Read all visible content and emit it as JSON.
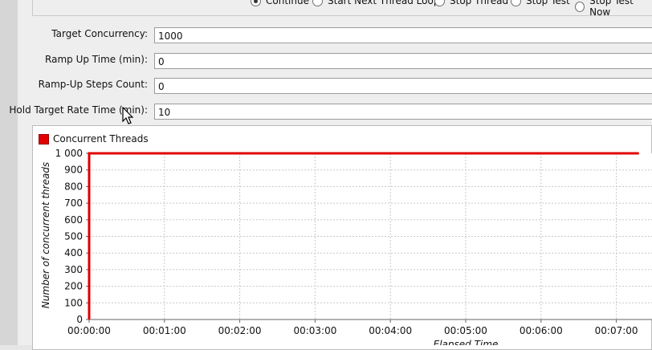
{
  "radio_options": [
    {
      "label": "Continue",
      "checked": true
    },
    {
      "label": "Start Next Thread Loop",
      "checked": false
    },
    {
      "label": "Stop Thread",
      "checked": false
    },
    {
      "label": "Stop Test",
      "checked": false
    },
    {
      "label": "Stop Test Now",
      "checked": false
    }
  ],
  "form": {
    "target_concurrency": {
      "label": "Target Concurrency:",
      "value": "1000"
    },
    "ramp_up_time": {
      "label": "Ramp Up Time (min):",
      "value": "0"
    },
    "ramp_up_steps": {
      "label": "Ramp-Up Steps Count:",
      "value": "0"
    },
    "hold_time": {
      "label": "Hold Target Rate Time (min):",
      "value": "10"
    }
  },
  "chart_data": {
    "type": "line",
    "legend": "top-left",
    "ylabel": "Number of concurrent threads",
    "xlabel": "Elapsed Time",
    "y_ticks": [
      "1 000",
      "900",
      "800",
      "700",
      "600",
      "500",
      "400",
      "300",
      "200",
      "100",
      "0"
    ],
    "x_ticks": [
      "00:00:00",
      "00:01:00",
      "00:02:00",
      "00:03:00",
      "00:04:00",
      "00:05:00",
      "00:06:00",
      "00:07:00"
    ],
    "ylim": [
      0,
      1000
    ],
    "xlim_minutes": [
      0,
      7.3
    ],
    "grid": true,
    "series": [
      {
        "name": "Concurrent Threads",
        "color": "#e00000",
        "points": [
          [
            0,
            0
          ],
          [
            0,
            1000
          ],
          [
            7.3,
            1000
          ]
        ]
      }
    ]
  }
}
